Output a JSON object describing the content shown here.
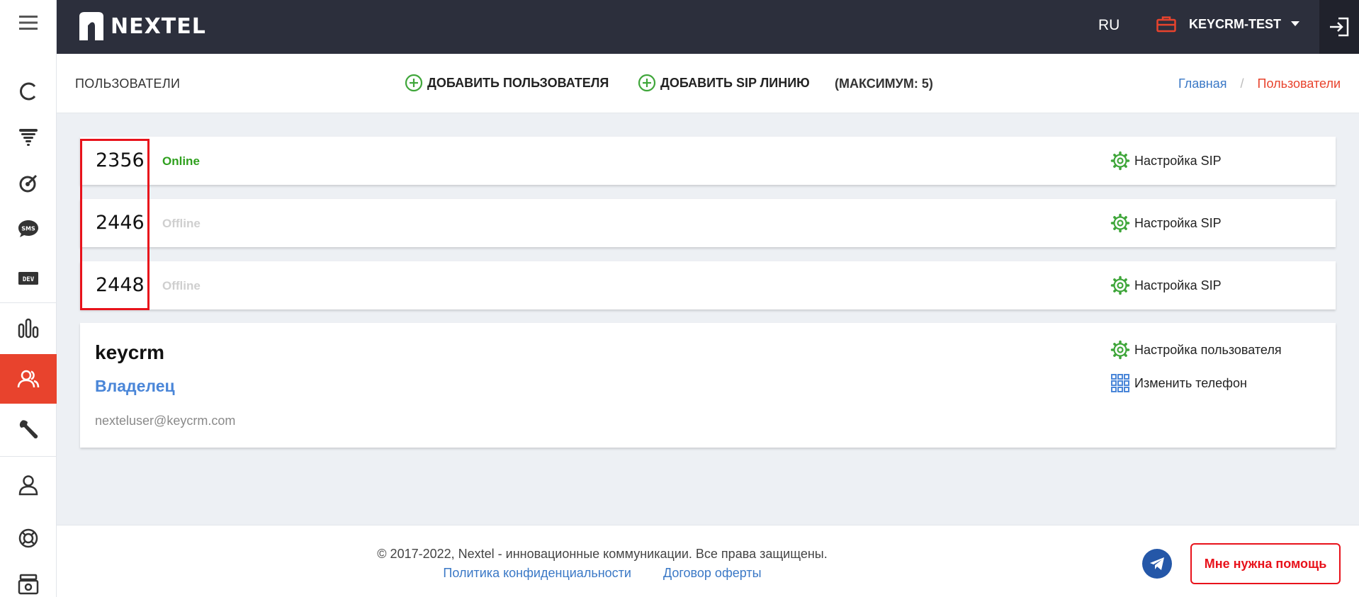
{
  "header": {
    "logo_text": "NEXTEL",
    "language": "RU",
    "account_name": "KEYCRM-TEST"
  },
  "sidebar": {
    "items": [
      {
        "icon": "refresh-icon"
      },
      {
        "icon": "funnel-icon"
      },
      {
        "icon": "radar-icon"
      },
      {
        "icon": "sms-icon",
        "label": "SMS"
      },
      {
        "icon": "dev-icon",
        "label": "DEV"
      },
      {
        "icon": "stats-icon"
      },
      {
        "icon": "users-icon",
        "active": true
      },
      {
        "icon": "wrench-icon"
      },
      {
        "icon": "user-icon"
      },
      {
        "icon": "lifebuoy-icon"
      },
      {
        "icon": "cashbox-icon"
      }
    ]
  },
  "subheader": {
    "page_title": "ПОЛЬЗОВАТЕЛИ",
    "add_user": "ДОБАВИТЬ ПОЛЬЗОВАТЕЛЯ",
    "add_sip": "ДОБАВИТЬ SIP ЛИНИЮ",
    "max_note": "(МАКСИМУМ: 5)",
    "breadcrumb": {
      "home": "Главная",
      "separator": "/",
      "current": "Пользователи"
    }
  },
  "sip_lines": [
    {
      "number": "2356",
      "status": "Online",
      "settings_label": "Настройка SIP"
    },
    {
      "number": "2446",
      "status": "Offline",
      "settings_label": "Настройка SIP"
    },
    {
      "number": "2448",
      "status": "Offline",
      "settings_label": "Настройка SIP"
    }
  ],
  "user": {
    "name": "keycrm",
    "role": "Владелец",
    "email": "nexteluser@keycrm.com",
    "settings_label": "Настройка пользователя",
    "change_phone_label": "Изменить телефон"
  },
  "footer": {
    "copyright": "© 2017-2022, Nextel - инновационные коммуникации. Все права защищены.",
    "privacy": "Политика конфиденциальности",
    "offer": "Договор оферты",
    "help_button": "Мне нужна помощь"
  },
  "colors": {
    "accent": "#e8432d",
    "online": "#2fa01e",
    "link": "#3a78c6",
    "header_bg": "#2c2f3c"
  }
}
